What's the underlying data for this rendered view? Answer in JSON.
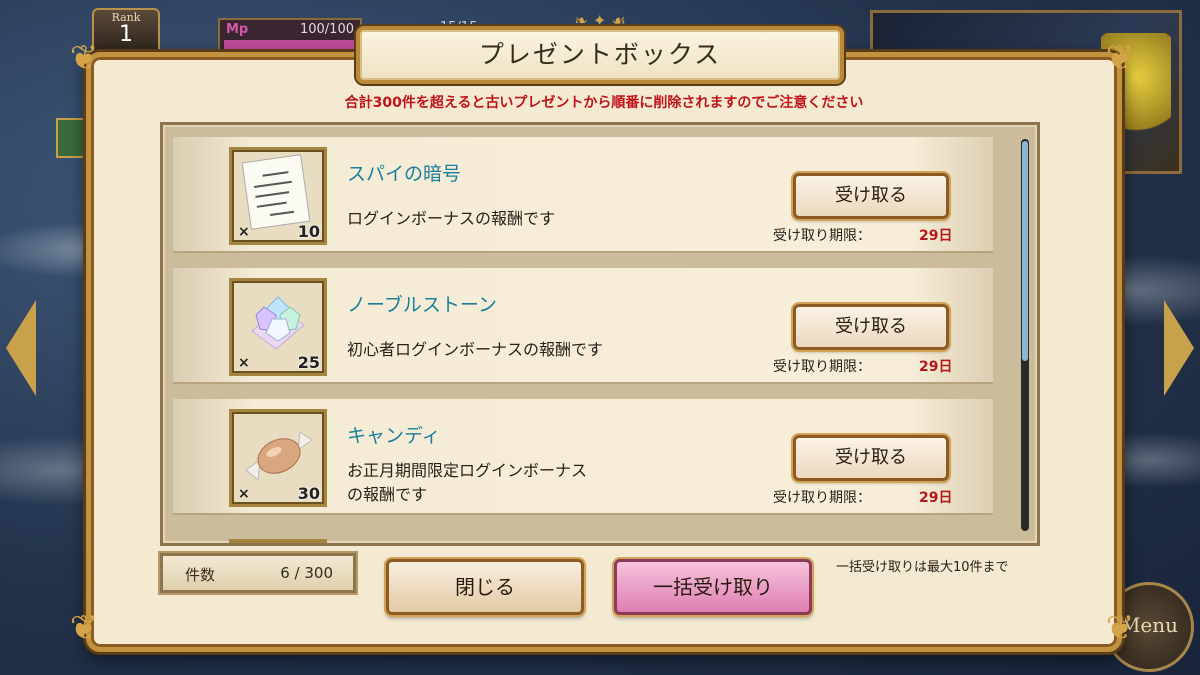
{
  "hud": {
    "rank_label": "Rank",
    "rank_value": "1",
    "mp_label": "Mp",
    "mp_value": "100/100",
    "stamina_value": "15/15",
    "menu_label": "Menu"
  },
  "dialog": {
    "title": "プレゼントボックス",
    "notice": "合計300件を超えると古いプレゼントから順番に削除されますのでご注意ください"
  },
  "items": [
    {
      "name": "スパイの暗号",
      "desc": "ログインボーナスの報酬です",
      "qty_x": "×",
      "qty": "10",
      "button": "受け取る",
      "limit_label": "受け取り期限：",
      "limit_value": "29日",
      "icon": "spy-code-letter-icon"
    },
    {
      "name": "ノーブルストーン",
      "desc": "初心者ログインボーナスの報酬です",
      "qty_x": "×",
      "qty": "25",
      "button": "受け取る",
      "limit_label": "受け取り期限：",
      "limit_value": "29日",
      "icon": "noble-stone-crystal-icon"
    },
    {
      "name": "キャンディ",
      "desc_line1": "お正月期間限定ログインボーナス",
      "desc_line2": "の報酬です",
      "qty_x": "×",
      "qty": "30",
      "button": "受け取る",
      "limit_label": "受け取り期限：",
      "limit_value": "29日",
      "icon": "candy-icon"
    }
  ],
  "footer": {
    "count_label": "件数",
    "count_value": "6 / 300",
    "close_button": "閉じる",
    "receive_all_button": "一括受け取り",
    "max_note": "一括受け取りは最大10件まで"
  },
  "colors": {
    "notice_red": "#c0141a",
    "item_name_teal": "#1a7f9a",
    "limit_red": "#b01a1a",
    "receive_all_pink": "#df7fb2",
    "gold_frame": "#c3923e"
  }
}
